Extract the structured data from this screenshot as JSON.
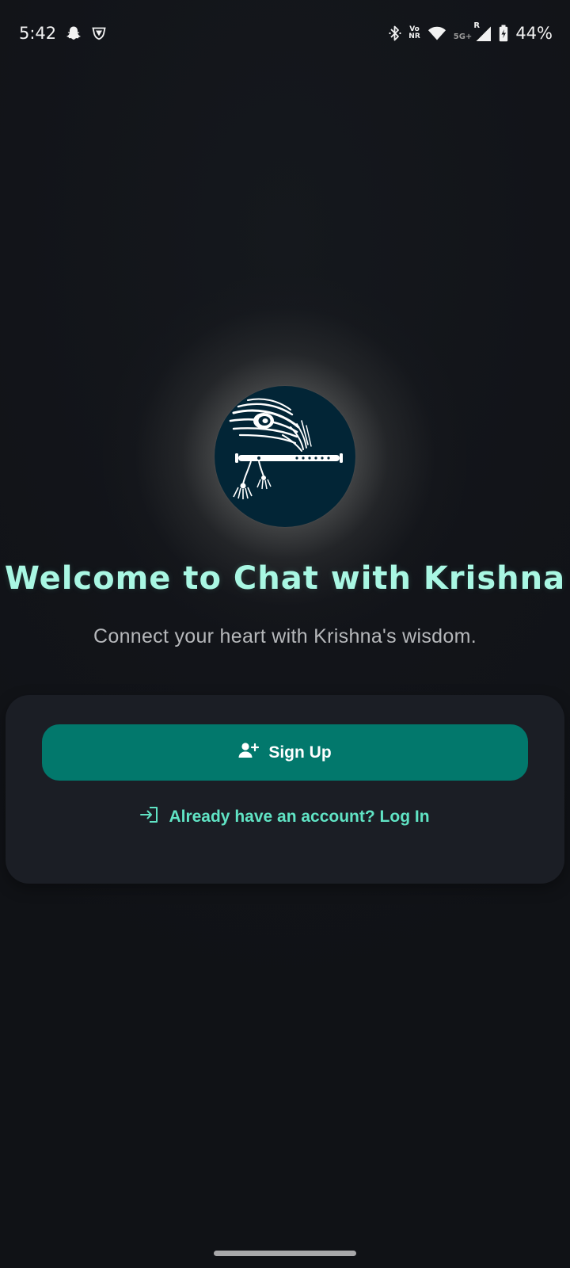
{
  "status_bar": {
    "time": "5:42",
    "battery": "44%",
    "volte_top": "Vo",
    "volte_bottom": "NR",
    "network_type": "5G+",
    "roaming": "R",
    "icons": [
      "snapchat-icon",
      "vpn-shield-icon",
      "bluetooth-icon",
      "volte-icon",
      "wifi-icon",
      "signal-icon",
      "battery-charging-icon"
    ]
  },
  "logo": {
    "icon": "peacock-feather-flute-icon",
    "background_color": "#022536"
  },
  "welcome": {
    "title": "Welcome to Chat with Krishna",
    "subtitle": "Connect your heart with Krishna's wisdom."
  },
  "auth_card": {
    "signup_label": "Sign Up",
    "signup_icon": "person-add-icon",
    "login_label": "Already have an account? Log In",
    "login_icon": "login-icon"
  },
  "colors": {
    "accent": "#02786c",
    "title": "#a9f7e3",
    "link": "#60e3c4",
    "card": "#1b1e25",
    "background": "#111317"
  }
}
